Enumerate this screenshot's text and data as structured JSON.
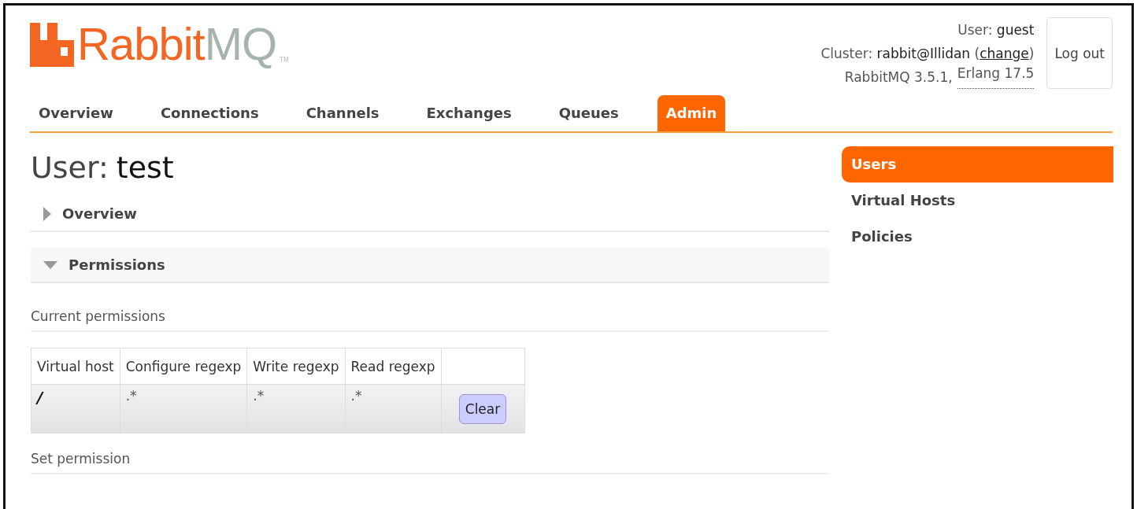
{
  "header": {
    "logo": {
      "brand": "Rabbit",
      "product": "MQ",
      "mark": "TM"
    },
    "user": {
      "label": "User:",
      "value": "guest"
    },
    "cluster": {
      "label": "Cluster:",
      "value": "rabbit@Illidan",
      "open": "(",
      "link": "change",
      "close": ")"
    },
    "versions": {
      "rabbitmq": "RabbitMQ 3.5.1,",
      "erlang": "Erlang 17.5"
    },
    "logout_button": "Log out"
  },
  "tabs": [
    {
      "label": "Overview",
      "selected": false
    },
    {
      "label": "Connections",
      "selected": false
    },
    {
      "label": "Channels",
      "selected": false
    },
    {
      "label": "Exchanges",
      "selected": false
    },
    {
      "label": "Queues",
      "selected": false
    },
    {
      "label": "Admin",
      "selected": true
    }
  ],
  "page_title": {
    "label": "User:",
    "value": "test"
  },
  "sections": [
    {
      "title": "Overview",
      "expanded": false
    },
    {
      "title": "Permissions",
      "expanded": true
    }
  ],
  "current_permissions": {
    "heading": "Current permissions",
    "table": {
      "columns": [
        "Virtual host",
        "Configure regexp",
        "Write regexp",
        "Read regexp"
      ],
      "rows": [
        {
          "cells": [
            "/",
            ".*",
            ".*",
            ".*"
          ],
          "action": "Clear"
        }
      ]
    }
  },
  "set_permission": {
    "heading": "Set permission"
  },
  "sidebar": {
    "items": [
      {
        "label": "Users",
        "selected": true
      },
      {
        "label": "Virtual Hosts",
        "selected": false
      },
      {
        "label": "Policies",
        "selected": false
      }
    ]
  }
}
